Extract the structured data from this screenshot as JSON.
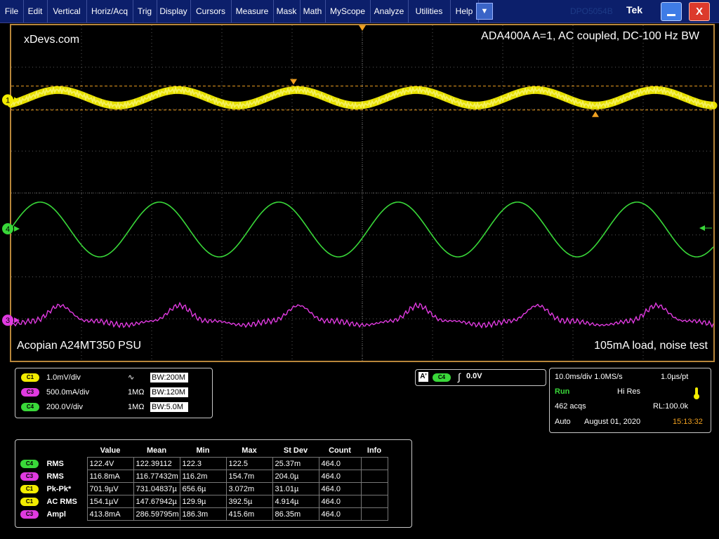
{
  "menu": {
    "items": [
      "File",
      "Edit",
      "Vertical",
      "Horiz/Acq",
      "Trig",
      "Display",
      "Cursors",
      "Measure",
      "Mask",
      "Math",
      "MyScope",
      "Analyze",
      "Utilities",
      "Help"
    ],
    "dropdown_glyph": "▼",
    "ghost_text": "DPO5054B",
    "brand": "Tek",
    "close_glyph": "X"
  },
  "screen": {
    "top_left_label": "xDevs.com",
    "top_right_label": "ADA400A A=1, AC coupled, DC-100 Hz BW",
    "bottom_left_label": "Acopian A24MT350 PSU",
    "bottom_right_label": "105mA load, noise test",
    "ch1_marker": "1",
    "ch4_marker": "4",
    "ch3_marker": "3"
  },
  "colors": {
    "ch1": "#f2ec00",
    "ch3": "#e03ae0",
    "ch4": "#39d839",
    "graticule_border": "#b8863a",
    "cursor": "#f0a020",
    "menu_bg": "#0c1f6b"
  },
  "waveforms": {
    "ch1_period_divs": 1.7,
    "ch4_period_divs": 1.7,
    "ch3_period_divs": 1.7
  },
  "channels": [
    {
      "badge": "C1",
      "scale": "1.0mV/div",
      "coupling_icon": "∿",
      "impedance": "",
      "bw": "200M",
      "color": "#f2ec00"
    },
    {
      "badge": "C3",
      "scale": "500.0mA/div",
      "coupling_icon": "",
      "impedance": "1MΩ",
      "bw": "120M",
      "color": "#e03ae0"
    },
    {
      "badge": "C4",
      "scale": "200.0V/div",
      "coupling_icon": "",
      "impedance": "1MΩ",
      "bw": "5.0M",
      "color": "#39d839"
    }
  ],
  "trigger": {
    "mode_icon": "A'",
    "source": "C4",
    "slope_icon": "∫",
    "level": "0.0V"
  },
  "acq": {
    "timebase": "10.0ms/div 1.0MS/s",
    "resolution": "1.0µs/pt",
    "state": "Run",
    "mode": "Hi Res",
    "acqs": "462 acqs",
    "record_length": "RL:100.0k",
    "trigger_mode": "Auto",
    "date": "August 01, 2020",
    "time": "15:13:32",
    "state_color": "#39d839",
    "time_color": "#f0a020"
  },
  "measurements": {
    "headers": [
      "Value",
      "Mean",
      "Min",
      "Max",
      "St Dev",
      "Count",
      "Info"
    ],
    "rows": [
      {
        "badge": "C4",
        "color": "#39d839",
        "name": "RMS",
        "value": "122.4V",
        "mean": "122.39112",
        "min": "122.3",
        "max": "122.5",
        "stdev": "25.37m",
        "count": "464.0",
        "info": ""
      },
      {
        "badge": "C3",
        "color": "#e03ae0",
        "name": "RMS",
        "value": "116.8mA",
        "mean": "116.77432m",
        "min": "116.2m",
        "max": "154.7m",
        "stdev": "204.0µ",
        "count": "464.0",
        "info": ""
      },
      {
        "badge": "C1",
        "color": "#f2ec00",
        "name": "Pk-Pk*",
        "value": "701.9µV",
        "mean": "731.04837µ",
        "min": "656.6µ",
        "max": "3.072m",
        "stdev": "31.01µ",
        "count": "464.0",
        "info": ""
      },
      {
        "badge": "C1",
        "color": "#f2ec00",
        "name": "AC RMS",
        "value": "154.1µV",
        "mean": "147.67942µ",
        "min": "129.9µ",
        "max": "392.5µ",
        "stdev": "4.914µ",
        "count": "464.0",
        "info": ""
      },
      {
        "badge": "C3",
        "color": "#e03ae0",
        "name": "Ampl",
        "value": "413.8mA",
        "mean": "286.59795m",
        "min": "186.3m",
        "max": "415.6m",
        "stdev": "86.35m",
        "count": "464.0",
        "info": ""
      }
    ]
  }
}
